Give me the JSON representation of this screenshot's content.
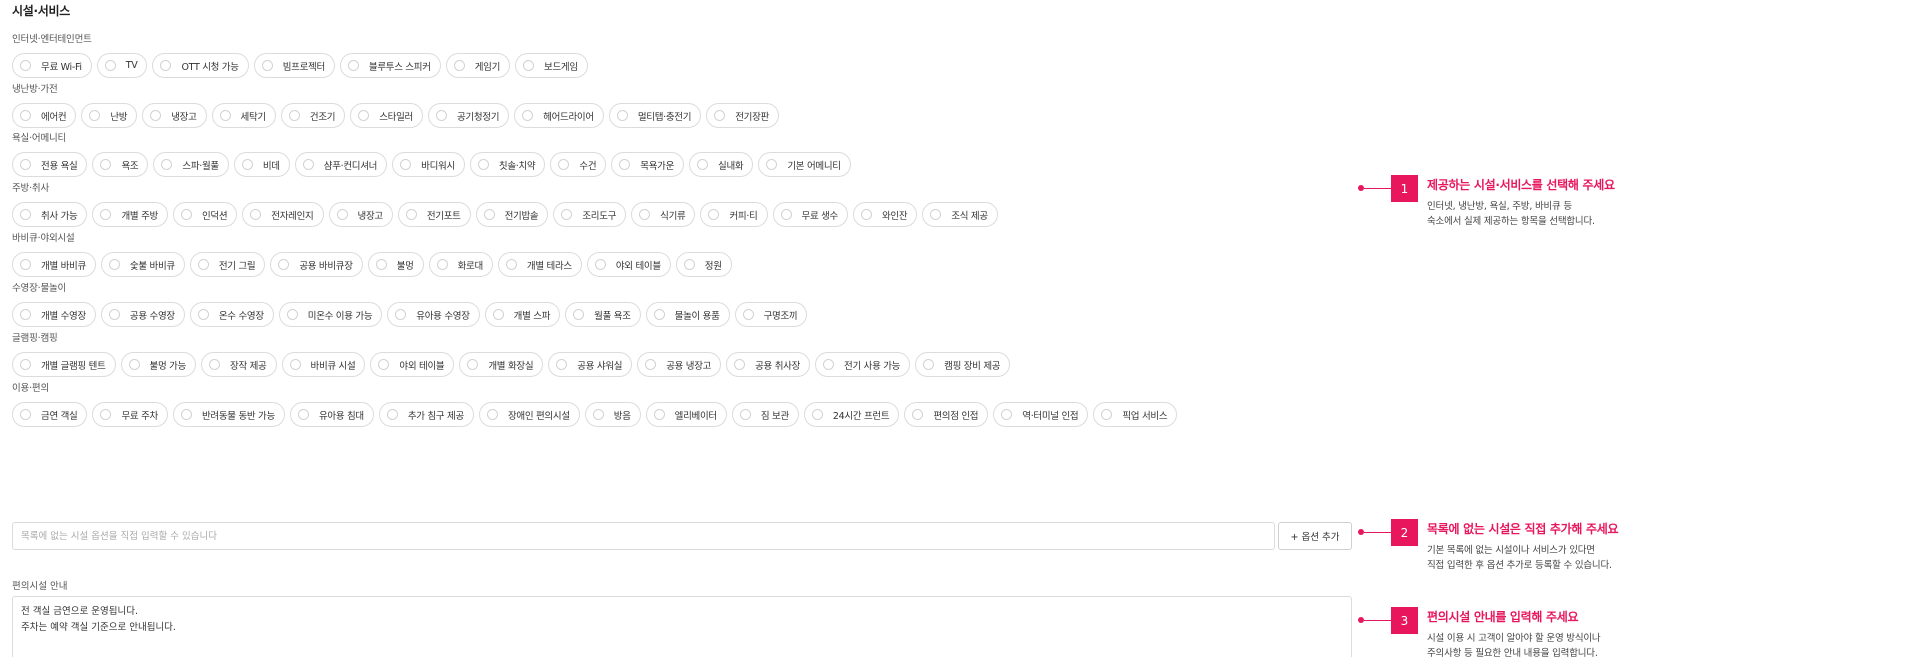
{
  "section_title": "시설·서비스",
  "groups": [
    {
      "title": "인터넷·엔터테인먼트",
      "options": [
        "무료 Wi-Fi",
        "TV",
        "OTT 시청 가능",
        "빔프로젝터",
        "블루투스 스피커",
        "게임기",
        "보드게임"
      ]
    },
    {
      "title": "냉난방·가전",
      "options": [
        "에어컨",
        "난방",
        "냉장고",
        "세탁기",
        "건조기",
        "스타일러",
        "공기청정기",
        "헤어드라이어",
        "멀티탭·충전기",
        "전기장판"
      ]
    },
    {
      "title": "욕실·어메니티",
      "options": [
        "전용 욕실",
        "욕조",
        "스파·월풀",
        "비데",
        "샴푸·컨디셔너",
        "바디워시",
        "칫솔·치약",
        "수건",
        "목욕가운",
        "실내화",
        "기본 어메니티"
      ]
    },
    {
      "title": "주방·취사",
      "options": [
        "취사 가능",
        "개별 주방",
        "인덕션",
        "전자레인지",
        "냉장고",
        "전기포트",
        "전기밥솥",
        "조리도구",
        "식기류",
        "커피·티",
        "무료 생수",
        "와인잔",
        "조식 제공"
      ]
    },
    {
      "title": "바비큐·야외시설",
      "options": [
        "개별 바비큐",
        "숯불 바비큐",
        "전기 그릴",
        "공용 바비큐장",
        "불멍",
        "화로대",
        "개별 테라스",
        "야외 테이블",
        "정원"
      ]
    },
    {
      "title": "수영장·물놀이",
      "options": [
        "개별 수영장",
        "공용 수영장",
        "온수 수영장",
        "미온수 이용 가능",
        "유아용 수영장",
        "개별 스파",
        "월풀 욕조",
        "물놀이 용품",
        "구명조끼"
      ]
    },
    {
      "title": "글램핑·캠핑",
      "options": [
        "개별 글램핑 텐트",
        "불멍 가능",
        "장작 제공",
        "바비큐 시설",
        "야외 테이블",
        "개별 화장실",
        "공용 샤워실",
        "공용 냉장고",
        "공용 취사장",
        "전기 사용 가능",
        "캠핑 장비 제공"
      ]
    },
    {
      "title": "이용·편의",
      "options": [
        "금연 객실",
        "무료 주차",
        "반려동물 동반 가능",
        "유아용 침대",
        "추가 침구 제공",
        "장애인 편의시설",
        "방음",
        "엘리베이터",
        "짐 보관",
        "24시간 프런트",
        "편의점 인접",
        "역·터미널 인접",
        "픽업 서비스"
      ]
    }
  ],
  "add_option": {
    "placeholder": "목록에 없는 시설 옵션을 직접 입력할 수 있습니다",
    "button_label": "+ 옵션 추가"
  },
  "notice": {
    "label": "편의시설 안내",
    "value": "전 객실 금연으로 운영됩니다.\n주차는 예약 객실 기준으로 안내됩니다."
  },
  "guides": [
    {
      "number": "1",
      "title": "제공하는 시설·서비스를 선택해 주세요",
      "desc_lines": [
        "인터넷, 냉난방, 욕실, 주방, 바비큐 등",
        "숙소에서 실제 제공하는 항목을 선택합니다."
      ]
    },
    {
      "number": "2",
      "title": "목록에 없는 시설은 직접 추가해 주세요",
      "desc_lines": [
        "기본 목록에 없는 시설이나 서비스가 있다면",
        "직접 입력한 후 옵션 추가로 등록할 수 있습니다."
      ]
    },
    {
      "number": "3",
      "title": "편의시설 안내를 입력해 주세요",
      "desc_lines": [
        "시설 이용 시 고객이 알아야 할 운영 방식이나",
        "주의사항 등 필요한 안내 내용을 입력합니다."
      ]
    }
  ],
  "colors": {
    "accent": "#e8175d",
    "border": "#dcdcdc"
  }
}
